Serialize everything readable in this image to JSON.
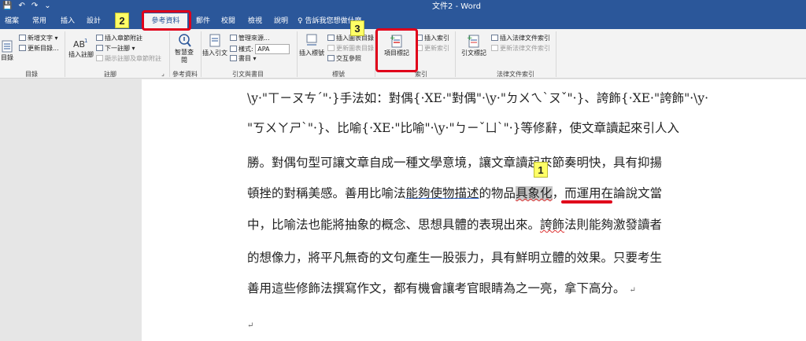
{
  "window": {
    "title": "文件2 - Word",
    "qat": [
      "💾",
      "↶",
      "↷",
      "⌄"
    ]
  },
  "tabs": [
    "檔案",
    "常用",
    "插入",
    "設計",
    "參考資料",
    "郵件",
    "校閱",
    "檢視",
    "說明"
  ],
  "tell_me": "告訴我您想做什麼",
  "ribbon": {
    "toc": {
      "label": "目錄",
      "update": "更新目錄...",
      "add_text": "新增文字",
      "group": "目錄"
    },
    "footnotes": {
      "insert_footnote": "插入註腳",
      "insert_endnote": "插入章節附註",
      "next_footnote": "下一註腳",
      "show_notes": "顯示註腳及章節附註",
      "group": "註腳"
    },
    "research": {
      "smart_lookup": "智慧查閱",
      "group": "參考資料"
    },
    "citations": {
      "insert_citation": "插入引文",
      "manage_sources": "管理來源...",
      "style_label": "樣式:",
      "style_value": "APA",
      "bibliography": "書目",
      "group": "引文與書目"
    },
    "captions": {
      "insert_caption": "插入標號",
      "insert_table_of_figures": "插入圖表目錄",
      "update_table": "更新圖表目錄",
      "cross_reference": "交互參照",
      "group": "標號"
    },
    "index": {
      "mark_entry": "項目標記",
      "insert_index": "插入索引",
      "update_index": "更新索引",
      "group": "索引"
    },
    "authorities": {
      "mark_citation": "引文標記",
      "insert_table": "插入法律文件索引",
      "update_table": "更新法律文件索引",
      "group": "法律文件索引"
    }
  },
  "document": {
    "line1": {
      "a": "\\y·\"ㄒㄧㄡㄘˊ\"·",
      "b": "}手法如：對偶{·XE·\"對偶\"·\\y·\"ㄉㄨㄟˋㄡˇ\"·",
      "c": "}、誇飾{·XE·\"誇飾\"·\\y·"
    },
    "line2": {
      "a": "\"ㄎㄨㄚㄕˋ\"·",
      "b": "}、比喻{·XE·\"比喻\"·\\y·\"ㄅㄧˇㄩˋ\"·",
      "c": "}等修辭，使文章讀起來引人入"
    },
    "line3": "勝。對偶句型可讓文章自成一種文學意境，讓文章讀起來節奏明快，具有抑揚",
    "line4": {
      "a": "頓挫的對稱美感。善用比喻法",
      "b": "能夠使物描述",
      "c": "的物品",
      "d": "具象化",
      "e": "，而運用在論說文當"
    },
    "line5": {
      "a": "中，比喻法也能將抽象的概念、思想具體的表現出來。",
      "b": "誇飾",
      "c": "法則能夠激發讀者"
    },
    "line6": "的想像力，將平凡無奇的文句產生一股張力，具有鮮明立體的效果。只要考生",
    "line7": "善用這些修飾法撰寫作文，都有機會讓考官眼睛為之一亮，拿下高分。",
    "para_mark": "↵"
  },
  "callouts": {
    "one": "1",
    "two": "2",
    "three": "3"
  }
}
